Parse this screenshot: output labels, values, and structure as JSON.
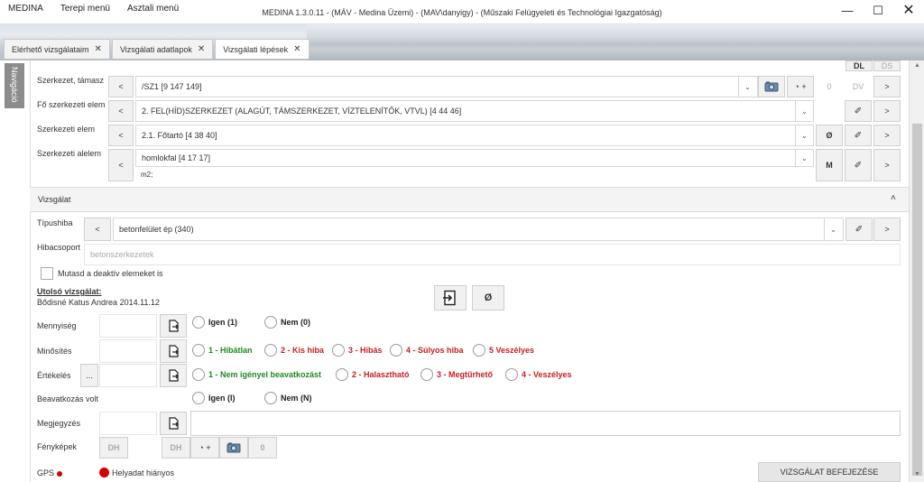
{
  "window": {
    "title": "MEDINA 1.3.0.11 - (MÁV - Medina Üzemi) - (MAV\\danyigy) - (Műszaki Felügyeleti és Technológiai Igazgatóság)",
    "menu": [
      "MEDINA",
      "Terepi menü",
      "Asztali menü"
    ],
    "controls": [
      "—",
      "☐",
      "✕"
    ]
  },
  "tabs": [
    {
      "label": "Elérhető vizsgálataim",
      "close": "✕"
    },
    {
      "label": "Vizsgálati adatlapok",
      "close": "✕"
    },
    {
      "label": "Vizsgálati lépések",
      "close": "✕"
    }
  ],
  "nav": {
    "label": "Navigáció"
  },
  "structure": {
    "partial_headers": [
      "DL",
      "DS"
    ],
    "rows": [
      {
        "label": "Szerkezet, támasz",
        "prev": "<",
        "value": "/SZ1 [9 147 149]",
        "extra1": "0",
        "extra2": "DV",
        "next": ">"
      },
      {
        "label": "Fő szerkezeti elem",
        "prev": "<",
        "value": "2. FEL(HÍD)SZERKEZET (ALAGÚT, TÁMSZERKEZET, VÍZTELENÍTŐK, VTVL) [4 44 46]",
        "next": ">"
      },
      {
        "label": "Szerkezeti elem",
        "prev": "<",
        "value": "2.1. Főtartó [4 38 40]",
        "extra1": "Ø",
        "next": ">"
      },
      {
        "label": "Szerkezeti alelem",
        "prev": "<",
        "value": "homlokfal [4 17 17]",
        "extra1": "M",
        "next": ">"
      }
    ],
    "unit": "m2;"
  },
  "inspection": {
    "section_title": "Vizsgálat",
    "collapse": "˄",
    "type_label": "Típushiba",
    "type_prev": "<",
    "type_value": "betonfelület ép (340)",
    "type_next": ">",
    "group_label": "Hibacsoport",
    "group_value": "betonszerkezetek",
    "show_inactive": "Mutasd a deaktív elemeket is",
    "last_label": "Utolsó vizsgálat:",
    "last_value": "Bődisné Katus Andrea 2014.11.12",
    "null_btn": "Ø",
    "quantity_label": "Mennyiség",
    "quantity_options": [
      "Igen (1)",
      "Nem (0)"
    ],
    "quality_label": "Minősítés",
    "quality_options": [
      "1 - Hibátlan",
      "2 - Kis hiba",
      "3 - Hibás",
      "4 - Súlyos hiba",
      "5 Veszélyes"
    ],
    "eval_label": "Értékelés",
    "eval_btn": "...",
    "eval_options": [
      "1 - Nem igényel beavatkozást",
      "2 - Halasztható",
      "3 - Megtűrhető",
      "4 - Veszélyes"
    ],
    "intervention_label": "Beavatkozás volt",
    "intervention_options": [
      "Igen (I)",
      "Nem (N)"
    ],
    "note_label": "Megjegyzés",
    "photos_label": "Fényképek",
    "photos_dh1": "DH",
    "photos_dh2": "DH",
    "photos_count": "0",
    "gps_label": "GPS",
    "location_status": "Helyadat hiányos",
    "finish_button": "VIZSGÁLAT BEFEJEZÉSE"
  },
  "colors": {
    "green": "#1e8a1e",
    "red": "#c81e1e",
    "gps_dot": "#d40000"
  }
}
